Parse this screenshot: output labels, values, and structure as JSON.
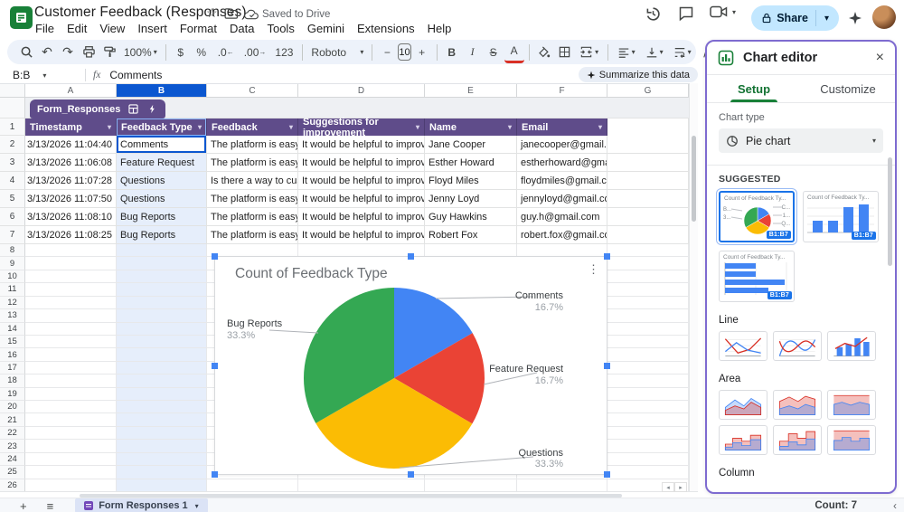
{
  "titlebar": {
    "title": "Customer Feedback (Responses)",
    "saved_status": "Saved to Drive",
    "menus": [
      "File",
      "Edit",
      "View",
      "Insert",
      "Format",
      "Data",
      "Tools",
      "Gemini",
      "Extensions",
      "Help"
    ],
    "share_label": "Share"
  },
  "toolbar": {
    "zoom": "100%",
    "currency": "$",
    "percent": "%",
    "decrease_decimal": ".0",
    "increase_decimal": ".00",
    "number_format": "123",
    "font": "Roboto",
    "font_size": "10",
    "bold": "B",
    "italic": "I",
    "strikethrough": "S",
    "text_color": "A"
  },
  "formula_bar": {
    "name_box": "B:B",
    "fx_label": "fx",
    "value": "Comments",
    "summarize_label": "Summarize this data"
  },
  "grid": {
    "column_letters": [
      "A",
      "B",
      "C",
      "D",
      "E",
      "F",
      "G"
    ],
    "selected_column": "B",
    "visible_rows": 26,
    "table_chip_label": "Form_Responses",
    "header_row": [
      "Timestamp",
      "Feedback Type",
      "Feedback",
      "Suggestions for improvement",
      "Name",
      "Email"
    ],
    "rows": [
      {
        "timestamp": "3/13/2026 11:04:40",
        "type": "Comments",
        "feedback": "The platform is easy to u",
        "suggestion": "It would be helpful to improve page",
        "name": "Jane Cooper",
        "email": "janecooper@gmail.com"
      },
      {
        "timestamp": "3/13/2026 11:06:08",
        "type": "Feature Request",
        "feedback": "The platform is easy to u",
        "suggestion": "It would be helpful to improve page",
        "name": "Esther Howard",
        "email": "estherhoward@gmail.com"
      },
      {
        "timestamp": "3/13/2026 11:07:28",
        "type": "Questions",
        "feedback": "Is there a way to custom",
        "suggestion": "It would be helpful to improve page",
        "name": "Floyd Miles",
        "email": "floydmiles@gmail.com"
      },
      {
        "timestamp": "3/13/2026 11:07:50",
        "type": "Questions",
        "feedback": "The platform is easy to u",
        "suggestion": "It would be helpful to improve page",
        "name": "Jenny Loyd",
        "email": "jennyloyd@gmail.com"
      },
      {
        "timestamp": "3/13/2026 11:08:10",
        "type": "Bug Reports",
        "feedback": "The platform is easy to u",
        "suggestion": "It would be helpful to improve page",
        "name": "Guy Hawkins",
        "email": "guy.h@gmail.com"
      },
      {
        "timestamp": "3/13/2026 11:08:25",
        "type": "Bug Reports",
        "feedback": "The platform is easy to u",
        "suggestion": "It would be helpful to improve page",
        "name": "Robert Fox",
        "email": "robert.fox@gmail.com"
      }
    ]
  },
  "chart": {
    "title": "Count of Feedback Type",
    "chart_data": {
      "type": "pie",
      "title": "Count of Feedback Type",
      "categories": [
        "Comments",
        "Feature Request",
        "Questions",
        "Bug Reports"
      ],
      "values": [
        16.7,
        16.7,
        33.3,
        33.3
      ],
      "value_labels": [
        "16.7%",
        "16.7%",
        "33.3%",
        "33.3%"
      ],
      "counts": [
        1,
        1,
        2,
        2
      ],
      "colors": [
        "#4285f4",
        "#ea4335",
        "#fbbc04",
        "#34a853"
      ],
      "legend_position": "labeled",
      "source_range": "B1:B7"
    }
  },
  "chart_editor": {
    "title": "Chart editor",
    "tabs": [
      "Setup",
      "Customize"
    ],
    "active_tab": "Setup",
    "chart_type_label": "Chart type",
    "chart_type_value": "Pie chart",
    "suggested_label": "SUGGESTED",
    "line_label": "Line",
    "area_label": "Area",
    "column_label": "Column",
    "thumb_title": "Count of Feedback Ty...",
    "range_badge": "B1:B7",
    "mini_pie_left_labels": [
      "B...",
      "3..."
    ],
    "mini_pie_right_labels": [
      "C...",
      "1...",
      "Q..."
    ]
  },
  "bottombar": {
    "sheet_tab": "Form Responses 1",
    "count": "Count: 7"
  }
}
